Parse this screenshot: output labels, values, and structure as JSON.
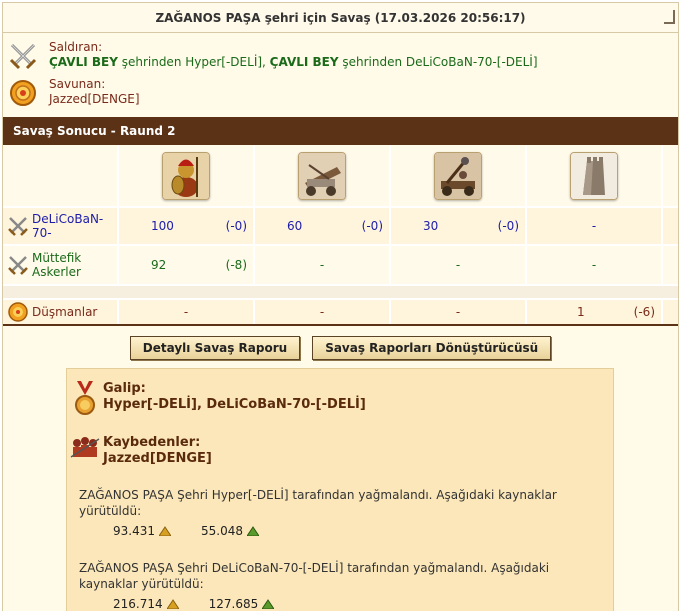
{
  "title": "ZAĞANOS PAŞA şehri için Savaş (17.03.2026 20:56:17)",
  "attacker": {
    "label": "Saldıran:",
    "city1": "ÇAVLI BEY",
    "mid1": " şehrinden Hyper[-DELİ], ",
    "city2": "ÇAVLI BEY",
    "mid2": " şehrinden DeLiCoBaN-70-[-DELİ]"
  },
  "defender": {
    "label": "Savunan:",
    "name": "Jazzed[DENGE]"
  },
  "section_title": "Savaş Sonucu - Raund 2",
  "units": [
    "spearman-unit",
    "ram-unit",
    "catapult-unit",
    "wall-unit"
  ],
  "rows": {
    "player": {
      "name": "DeLiCoBaN-70-",
      "cells": [
        {
          "count": "100",
          "loss": "(-0)"
        },
        {
          "count": "60",
          "loss": "(-0)"
        },
        {
          "count": "30",
          "loss": "(-0)"
        },
        {
          "count": "-",
          "loss": ""
        }
      ]
    },
    "ally": {
      "name": "Müttefik Askerler",
      "cells": [
        {
          "count": "92",
          "loss": "(-8)"
        },
        {
          "count": "-",
          "loss": ""
        },
        {
          "count": "-",
          "loss": ""
        },
        {
          "count": "-",
          "loss": ""
        }
      ]
    },
    "enemy": {
      "name": "Düşmanlar",
      "cells": [
        {
          "count": "-",
          "loss": ""
        },
        {
          "count": "-",
          "loss": ""
        },
        {
          "count": "-",
          "loss": ""
        },
        {
          "count": "1",
          "loss": "(-6)"
        }
      ]
    }
  },
  "buttons": {
    "report": "Detaylı Savaş Raporu",
    "converter": "Savaş Raporları Dönüştürücüsü"
  },
  "result": {
    "winner_label": "Galip:",
    "winner": "Hyper[-DELİ], DeLiCoBaN-70-[-DELİ]",
    "loser_label": "Kaybedenler:",
    "loser": "Jazzed[DENGE]",
    "plunder1": "ZAĞANOS PAŞA Şehri Hyper[-DELİ] tarafından yağmalandı. Aşağıdaki kaynaklar yürütüldü:",
    "p1_gold": "93.431",
    "p1_food": "55.048",
    "plunder2": "ZAĞANOS PAŞA Şehri DeLiCoBaN-70-[-DELİ] tarafından yağmalandı. Aşağıdaki kaynaklar yürütüldü:",
    "p2_gold": "216.714",
    "p2_food": "127.685"
  },
  "colors": {
    "header_brown": "#5b3216",
    "blue_text": "#1c1caa",
    "green_text": "#1a6a1a",
    "enemy_text": "#7a2a1a"
  }
}
